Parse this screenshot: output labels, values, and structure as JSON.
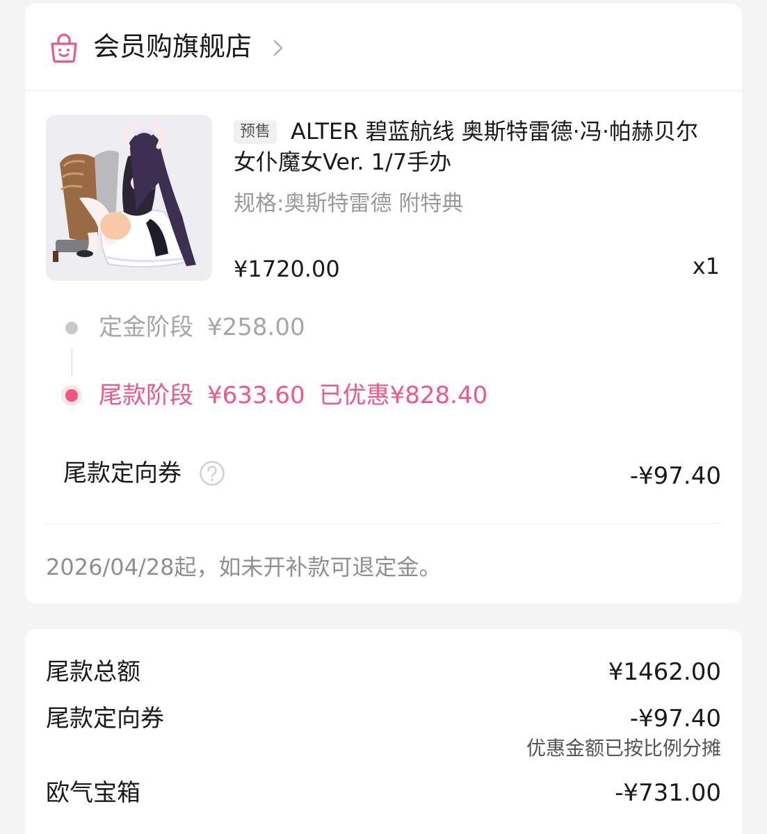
{
  "store": {
    "name": "会员购旗舰店",
    "icon": "shopping-bag-icon",
    "accent": "#f0568a"
  },
  "product": {
    "presale_tag": "预售",
    "title": "ALTER 碧蓝航线 奥斯特雷德·冯·帕赫贝尔 女仆魔女Ver. 1/7手办",
    "spec": "规格:奥斯特雷德 附特典",
    "price": "¥1720.00",
    "quantity": "x1"
  },
  "stages": {
    "deposit": {
      "label": "定金阶段",
      "amount": "¥258.00",
      "color": "#a6a6a6"
    },
    "balance": {
      "label": "尾款阶段",
      "amount": "¥633.60",
      "discount": "已优惠¥828.40",
      "color": "#f0568a"
    }
  },
  "coupon": {
    "label": "尾款定向券",
    "value": "-¥97.40",
    "help_icon": "question-icon"
  },
  "refund_note": "2026/04/28起，如未开补款可退定金。",
  "summary": {
    "total_label": "尾款总额",
    "total_value": "¥1462.00",
    "coupon_label": "尾款定向券",
    "coupon_value": "-¥97.40",
    "coupon_note": "优惠金额已按比例分摊",
    "chest_label": "欧气宝箱",
    "chest_value": "-¥731.00"
  }
}
